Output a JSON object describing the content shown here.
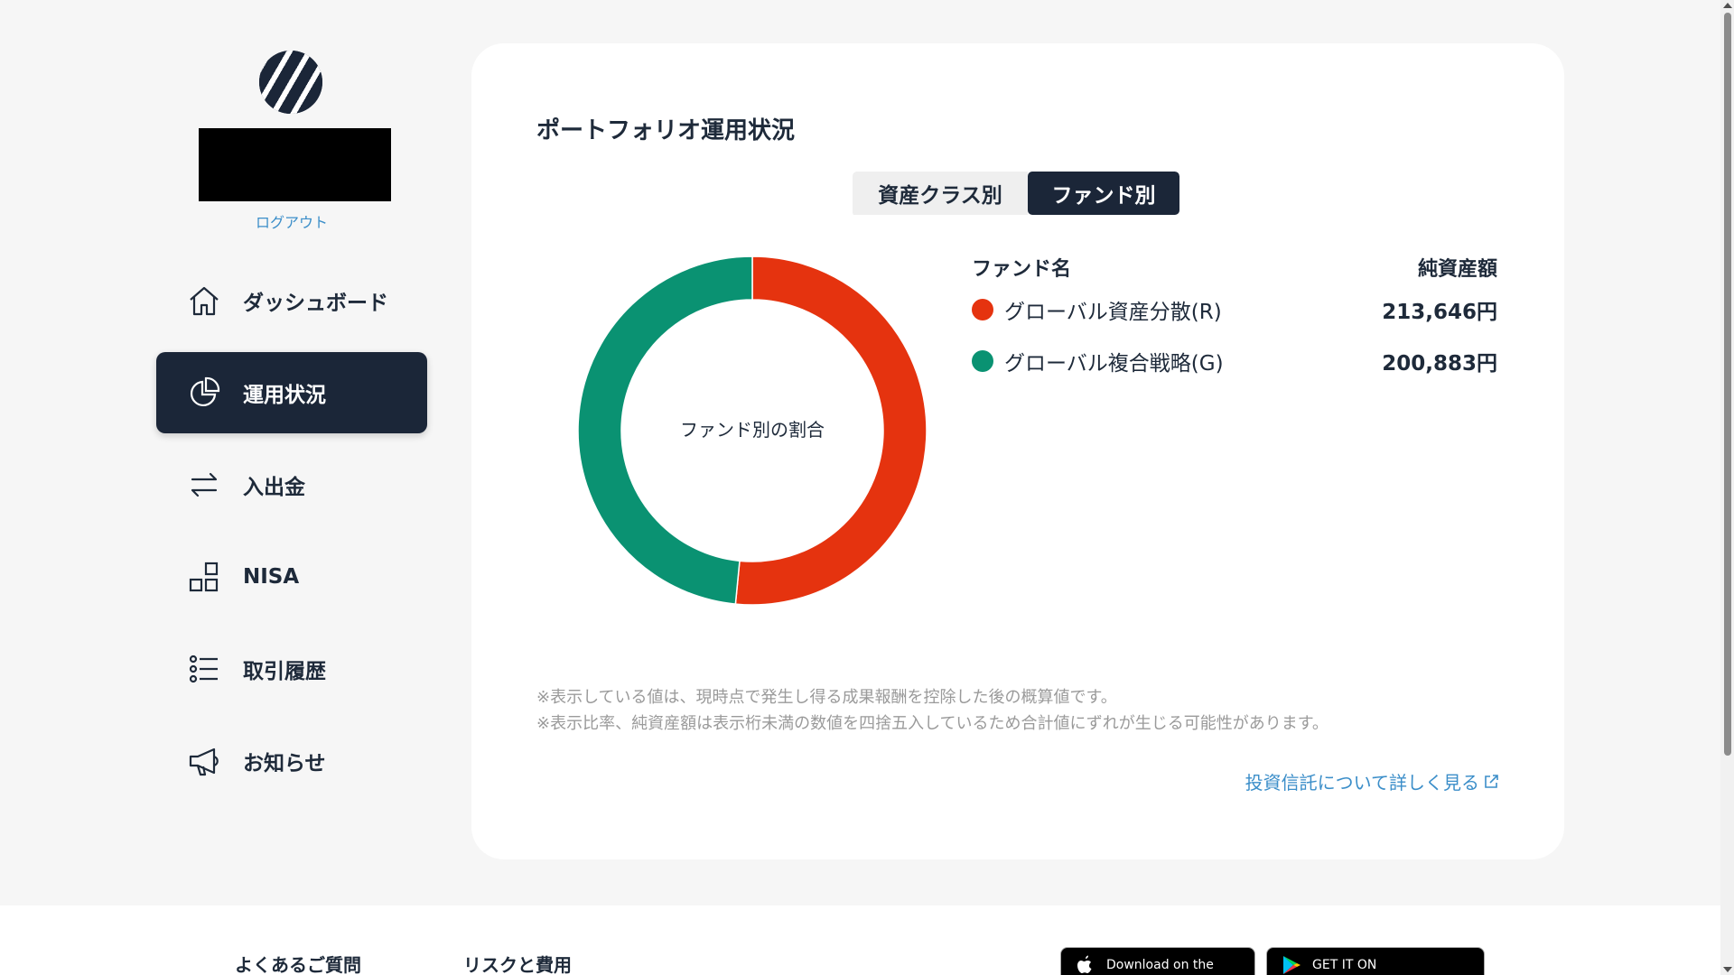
{
  "user": {
    "logout_label": "ログアウト"
  },
  "sidebar": {
    "items": [
      {
        "label": "ダッシュボード",
        "icon": "home-icon",
        "active": false
      },
      {
        "label": "運用状況",
        "icon": "pie-chart-icon",
        "active": true
      },
      {
        "label": "入出金",
        "icon": "transfer-arrows-icon",
        "active": false
      },
      {
        "label": "NISA",
        "icon": "blocks-icon",
        "active": false
      },
      {
        "label": "取引履歴",
        "icon": "list-icon",
        "active": false
      },
      {
        "label": "お知らせ",
        "icon": "megaphone-icon",
        "active": false
      }
    ]
  },
  "portfolio": {
    "title": "ポートフォリオ運用状況",
    "tabs": [
      {
        "label": "資産クラス別",
        "active": false
      },
      {
        "label": "ファンド別",
        "active": true
      }
    ],
    "donut_center_label": "ファンド別の割合",
    "legend_header_name": "ファンド名",
    "legend_header_value": "純資産額",
    "funds": [
      {
        "name": "グローバル資産分散(R)",
        "value": "213,646円",
        "color": "#e5330f"
      },
      {
        "name": "グローバル複合戦略(G)",
        "value": "200,883円",
        "color": "#0a9272"
      }
    ],
    "notes": [
      "※表示している値は、現時点で発生し得る成果報酬を控除した後の概算値です。",
      "※表示比率、純資産額は表示桁未満の数値を四捨五入しているため合計値にずれが生じる可能性があります。"
    ],
    "more_link": "投資信託について詳しく見る"
  },
  "chart_data": {
    "type": "pie",
    "categories": [
      "グローバル資産分散(R)",
      "グローバル複合戦略(G)"
    ],
    "values": [
      213646,
      200883
    ],
    "colors": [
      "#e5330f",
      "#0a9272"
    ],
    "title": "ファンド別の割合"
  },
  "footer": {
    "links": [
      "よくあるご質問",
      "リスクと費用"
    ],
    "app_store_label": "Download on the",
    "google_play_label": "GET IT ON"
  },
  "colors": {
    "navy": "#1b2638",
    "link": "#3b8ec9",
    "card": "#ffffff",
    "background": "#f6f6f6"
  }
}
